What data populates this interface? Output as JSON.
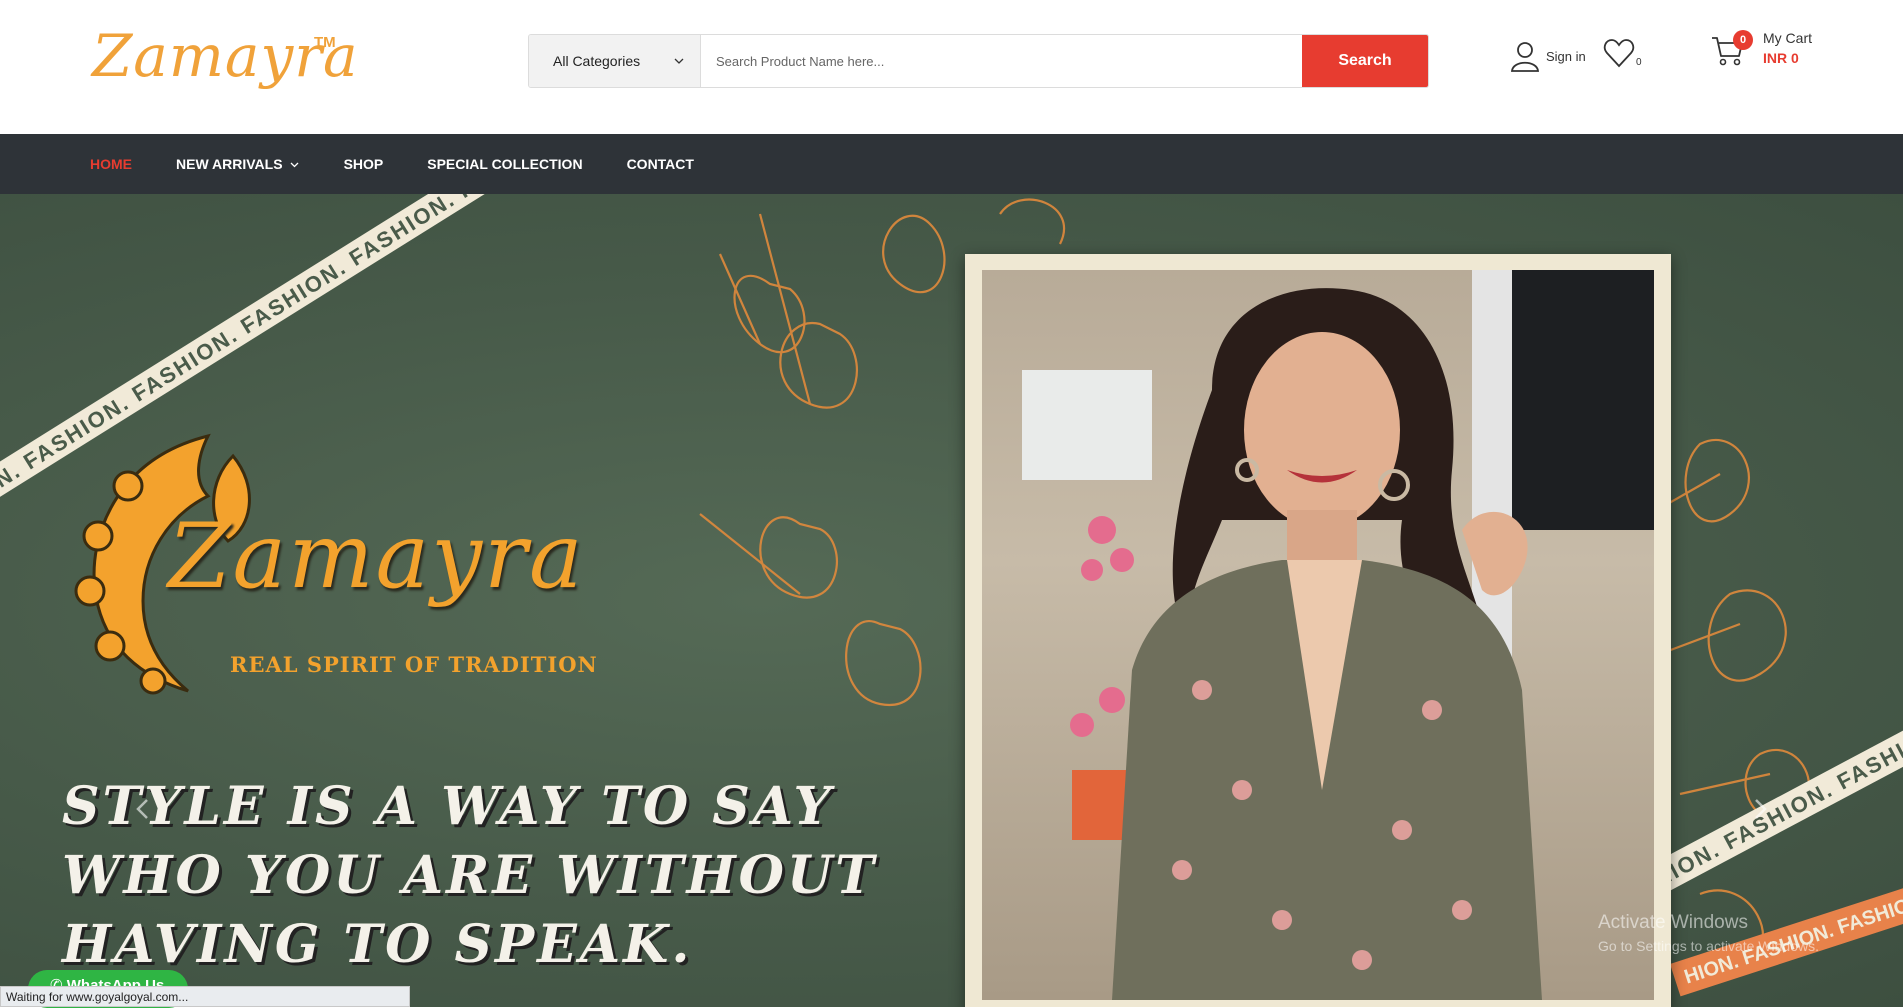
{
  "header": {
    "logo_text": "Zamayra",
    "logo_tm": "TM",
    "search": {
      "category_label": "All Categories",
      "placeholder": "Search Product Name here...",
      "button_label": "Search"
    },
    "signin_label": "Sign in",
    "wishlist_count": "0",
    "cart": {
      "count": "0",
      "label": "My Cart",
      "total": "INR 0"
    }
  },
  "nav": {
    "items": [
      {
        "label": "HOME",
        "active": true
      },
      {
        "label": "NEW ARRIVALS",
        "has_dropdown": true
      },
      {
        "label": "SHOP"
      },
      {
        "label": "SPECIAL COLLECTION"
      },
      {
        "label": "CONTACT"
      }
    ]
  },
  "hero": {
    "ribbon_text": "N. FASHION. FASHION. FASHION. FASHION. FASHION.",
    "ribbon_text_2": "FASHION. FASHION. FASHION. FASHION. FASHION.",
    "ribbon_text_3": "HION. FASHION. FASHION",
    "brand_name": "Zamayra",
    "brand_tagline": "REAL SPIRIT OF TRADITION",
    "quote_lines": [
      "STYLE IS A WAY TO SAY",
      "WHO YOU ARE WITHOUT",
      "HAVING TO SPEAK."
    ]
  },
  "overlay": {
    "watermark_title": "Activate Windows",
    "watermark_subtitle": "Go to Settings to activate Windows.",
    "whatsapp_label": "WhatsApp Us",
    "status_text": "Waiting for www.goyalgoyal.com..."
  },
  "colors": {
    "accent": "#e73c30",
    "brand_orange": "#f0a23a",
    "nav_bg": "#2e3338",
    "hero_green": "#475a49"
  }
}
